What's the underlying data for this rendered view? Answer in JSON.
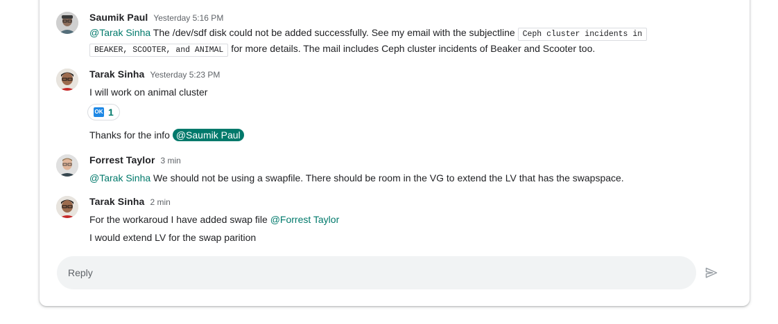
{
  "messages": [
    {
      "author": "Saumik Paul",
      "time": "Yesterday 5:16 PM",
      "mention": "@Tarak Sinha",
      "text_a": " The /dev/sdf disk could not be added successfully. See my email with the subjectline ",
      "code_line1": "Ceph cluster incidents in",
      "code_line2": "BEAKER, SCOOTER, and ANIMAL",
      "text_b": " for more details. The mail includes Ceph cluster incidents of Beaker and Scooter too."
    },
    {
      "author": "Tarak Sinha",
      "time": "Yesterday 5:23 PM",
      "line1": "I will work on animal cluster",
      "reaction": {
        "emoji": "OK",
        "count": "1"
      },
      "line2": "Thanks for the info ",
      "line2_mention": "@Saumik Paul"
    },
    {
      "author": "Forrest Taylor",
      "time": "3 min",
      "mention": "@Tarak Sinha",
      "text": " We should not be using a swapfile.  There should be room in the VG to extend the LV that has the swapspace."
    },
    {
      "author": "Tarak Sinha",
      "time": "2 min",
      "line1": "For the workaroud I have added swap file ",
      "line1_mention": "@Forrest Taylor",
      "line2": "I would extend LV for the swap parition"
    }
  ],
  "reply": {
    "placeholder": "Reply"
  },
  "icons": {
    "send": "send-icon",
    "reaction": "ok-button-emoji"
  },
  "colors": {
    "mention": "#00796b",
    "reply_bg": "#f1f3f4"
  }
}
